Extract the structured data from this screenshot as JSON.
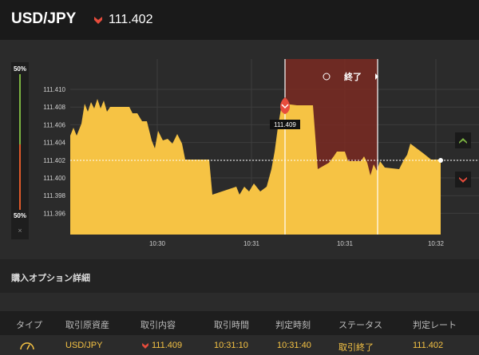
{
  "header": {
    "pair": "USD/JPY",
    "rate": "111.402",
    "direction_icon": "chevron-down-icon",
    "down_color": "#e74c3c"
  },
  "chart": {
    "y_ticks": [
      "111.410",
      "111.408",
      "111.406",
      "111.404",
      "111.402",
      "111.400",
      "111.398",
      "111.396"
    ],
    "x_ticks": [
      "10:30",
      "10:31",
      "10:31",
      "10:32"
    ],
    "current_rate": "111.402",
    "entry_label": "111.409",
    "zone_label": "終了",
    "fill_color": "#f6c344",
    "zone_color": "#7a2a22"
  },
  "gauge": {
    "top": "50%",
    "bottom": "50%",
    "close": "×"
  },
  "section": {
    "title": "購入オプション詳細"
  },
  "table": {
    "headers": [
      "タイプ",
      "取引原資産",
      "取引内容",
      "取引時間",
      "判定時刻",
      "ステータス",
      "判定レート"
    ],
    "rows": [
      {
        "type_icon": "gauge-icon",
        "asset": "USD/JPY",
        "trade": "111.409",
        "time": "10:31:10",
        "judge_time": "10:31:40",
        "status": "取引終了",
        "rate": "111.402"
      }
    ]
  }
}
